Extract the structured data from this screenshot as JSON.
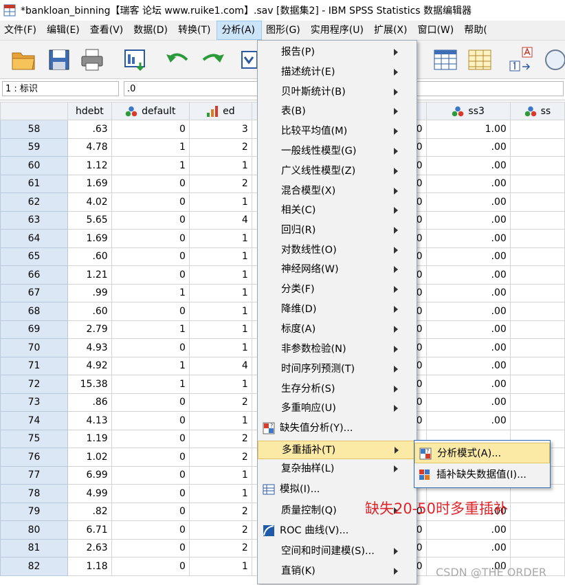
{
  "window": {
    "title": "*bankloan_binning【瑞客 论坛 www.ruike1.com】.sav [数据集2] - IBM SPSS Statistics 数据编辑器"
  },
  "menubar": [
    "文件(F)",
    "编辑(E)",
    "查看(V)",
    "数据(D)",
    "转换(T)",
    "分析(A)",
    "图形(G)",
    "实用程序(U)",
    "扩展(X)",
    "窗口(W)",
    "帮助("
  ],
  "refbar": {
    "cell": "1 : 标识",
    "value": ".0"
  },
  "columns": [
    {
      "name": "",
      "icon": ""
    },
    {
      "name": "hdebt",
      "icon": ""
    },
    {
      "name": "default",
      "icon": "nominal-measure-icon"
    },
    {
      "name": "ed",
      "icon": "ordinal-measure-icon"
    },
    {
      "name": "",
      "icon": ""
    },
    {
      "name": "",
      "icon": ""
    },
    {
      "name": "ss3",
      "icon": "nominal-measure-icon"
    },
    {
      "name": "ss",
      "icon": "nominal-measure-icon"
    }
  ],
  "rows": [
    {
      "id": "58",
      "hdebt": ".63",
      "default": "0",
      "ed": "3",
      "c5": "0",
      "ss3": "1.00"
    },
    {
      "id": "59",
      "hdebt": "4.78",
      "default": "1",
      "ed": "2",
      "c5": "0",
      "ss3": ".00"
    },
    {
      "id": "60",
      "hdebt": "1.12",
      "default": "1",
      "ed": "1",
      "c5": "0",
      "ss3": ".00"
    },
    {
      "id": "61",
      "hdebt": "1.69",
      "default": "0",
      "ed": "2",
      "c5": "0",
      "ss3": ".00"
    },
    {
      "id": "62",
      "hdebt": "4.02",
      "default": "0",
      "ed": "1",
      "c5": "0",
      "ss3": ".00"
    },
    {
      "id": "63",
      "hdebt": "5.65",
      "default": "0",
      "ed": "4",
      "c5": "0",
      "ss3": ".00"
    },
    {
      "id": "64",
      "hdebt": "1.69",
      "default": "0",
      "ed": "1",
      "c5": "0",
      "ss3": ".00"
    },
    {
      "id": "65",
      "hdebt": ".60",
      "default": "0",
      "ed": "1",
      "c5": "0",
      "ss3": ".00"
    },
    {
      "id": "66",
      "hdebt": "1.21",
      "default": "0",
      "ed": "1",
      "c5": "0",
      "ss3": ".00"
    },
    {
      "id": "67",
      "hdebt": ".99",
      "default": "1",
      "ed": "1",
      "c5": "0",
      "ss3": ".00"
    },
    {
      "id": "68",
      "hdebt": ".60",
      "default": "0",
      "ed": "1",
      "c5": "0",
      "ss3": ".00"
    },
    {
      "id": "69",
      "hdebt": "2.79",
      "default": "1",
      "ed": "1",
      "c5": "0",
      "ss3": ".00"
    },
    {
      "id": "70",
      "hdebt": "4.93",
      "default": "0",
      "ed": "1",
      "c5": "0",
      "ss3": ".00"
    },
    {
      "id": "71",
      "hdebt": "4.92",
      "default": "1",
      "ed": "4",
      "c5": "0",
      "ss3": ".00"
    },
    {
      "id": "72",
      "hdebt": "15.38",
      "default": "1",
      "ed": "1",
      "c5": "0",
      "ss3": ".00"
    },
    {
      "id": "73",
      "hdebt": ".86",
      "default": "0",
      "ed": "2",
      "c5": "0",
      "ss3": ".00"
    },
    {
      "id": "74",
      "hdebt": "4.13",
      "default": "0",
      "ed": "1",
      "c5": "0",
      "ss3": ".00"
    },
    {
      "id": "75",
      "hdebt": "1.19",
      "default": "0",
      "ed": "2",
      "c5": "",
      "ss3": ""
    },
    {
      "id": "76",
      "hdebt": "1.02",
      "default": "0",
      "ed": "2",
      "c5": "",
      "ss3": ""
    },
    {
      "id": "77",
      "hdebt": "6.99",
      "default": "0",
      "ed": "1",
      "c5": "",
      "ss3": ""
    },
    {
      "id": "78",
      "hdebt": "4.99",
      "default": "0",
      "ed": "1",
      "c5": "",
      "ss3": ""
    },
    {
      "id": "79",
      "hdebt": ".82",
      "default": "0",
      "ed": "2",
      "c5": "0",
      "ss3": ".00"
    },
    {
      "id": "80",
      "hdebt": "6.71",
      "default": "0",
      "ed": "2",
      "c5": "0",
      "ss3": ".00"
    },
    {
      "id": "81",
      "hdebt": "2.63",
      "default": "0",
      "ed": "2",
      "c5": "0",
      "ss3": ".00"
    },
    {
      "id": "82",
      "hdebt": "1.18",
      "default": "0",
      "ed": "1",
      "c5": "0",
      "ss3": ".00"
    }
  ],
  "analyze_menu": [
    {
      "label": "报告(P)",
      "submenu": true,
      "icon": ""
    },
    {
      "label": "描述统计(E)",
      "submenu": true,
      "icon": ""
    },
    {
      "label": "贝叶斯统计(B)",
      "submenu": true,
      "icon": ""
    },
    {
      "label": "表(B)",
      "submenu": true,
      "icon": ""
    },
    {
      "label": "比较平均值(M)",
      "submenu": true,
      "icon": ""
    },
    {
      "label": "一般线性模型(G)",
      "submenu": true,
      "icon": ""
    },
    {
      "label": "广义线性模型(Z)",
      "submenu": true,
      "icon": ""
    },
    {
      "label": "混合模型(X)",
      "submenu": true,
      "icon": ""
    },
    {
      "label": "相关(C)",
      "submenu": true,
      "icon": ""
    },
    {
      "label": "回归(R)",
      "submenu": true,
      "icon": ""
    },
    {
      "label": "对数线性(O)",
      "submenu": true,
      "icon": ""
    },
    {
      "label": "神经网络(W)",
      "submenu": true,
      "icon": ""
    },
    {
      "label": "分类(F)",
      "submenu": true,
      "icon": ""
    },
    {
      "label": "降维(D)",
      "submenu": true,
      "icon": ""
    },
    {
      "label": "标度(A)",
      "submenu": true,
      "icon": ""
    },
    {
      "label": "非参数检验(N)",
      "submenu": true,
      "icon": ""
    },
    {
      "label": "时间序列预测(T)",
      "submenu": true,
      "icon": ""
    },
    {
      "label": "生存分析(S)",
      "submenu": true,
      "icon": ""
    },
    {
      "label": "多重响应(U)",
      "submenu": true,
      "icon": ""
    },
    {
      "label": "缺失值分析(Y)...",
      "submenu": false,
      "icon": "missing-value-analysis-icon"
    },
    {
      "label": "多重插补(T)",
      "submenu": true,
      "icon": "",
      "highlighted": true
    },
    {
      "label": "复杂抽样(L)",
      "submenu": true,
      "icon": ""
    },
    {
      "label": "模拟(I)...",
      "submenu": false,
      "icon": "simulation-icon"
    },
    {
      "label": "质量控制(Q)",
      "submenu": true,
      "icon": ""
    },
    {
      "label": "ROC 曲线(V)...",
      "submenu": false,
      "icon": "roc-curve-icon"
    },
    {
      "label": "空间和时间建模(S)...",
      "submenu": true,
      "icon": ""
    },
    {
      "label": "直销(K)",
      "submenu": true,
      "icon": ""
    }
  ],
  "imputation_submenu": [
    {
      "label": "分析模式(A)...",
      "icon": "analyze-patterns-icon",
      "highlighted": true
    },
    {
      "label": "插补缺失数据值(I)...",
      "icon": "impute-missing-icon"
    }
  ],
  "annotation": "缺失20-50时多重插补",
  "watermark": "CSDN @THE ORDER",
  "colors": {
    "highlight": "#fbe9a6",
    "annotation": "#e0242a",
    "rowheader": "#dbe7f5",
    "active_menu": "#cce4f7"
  }
}
